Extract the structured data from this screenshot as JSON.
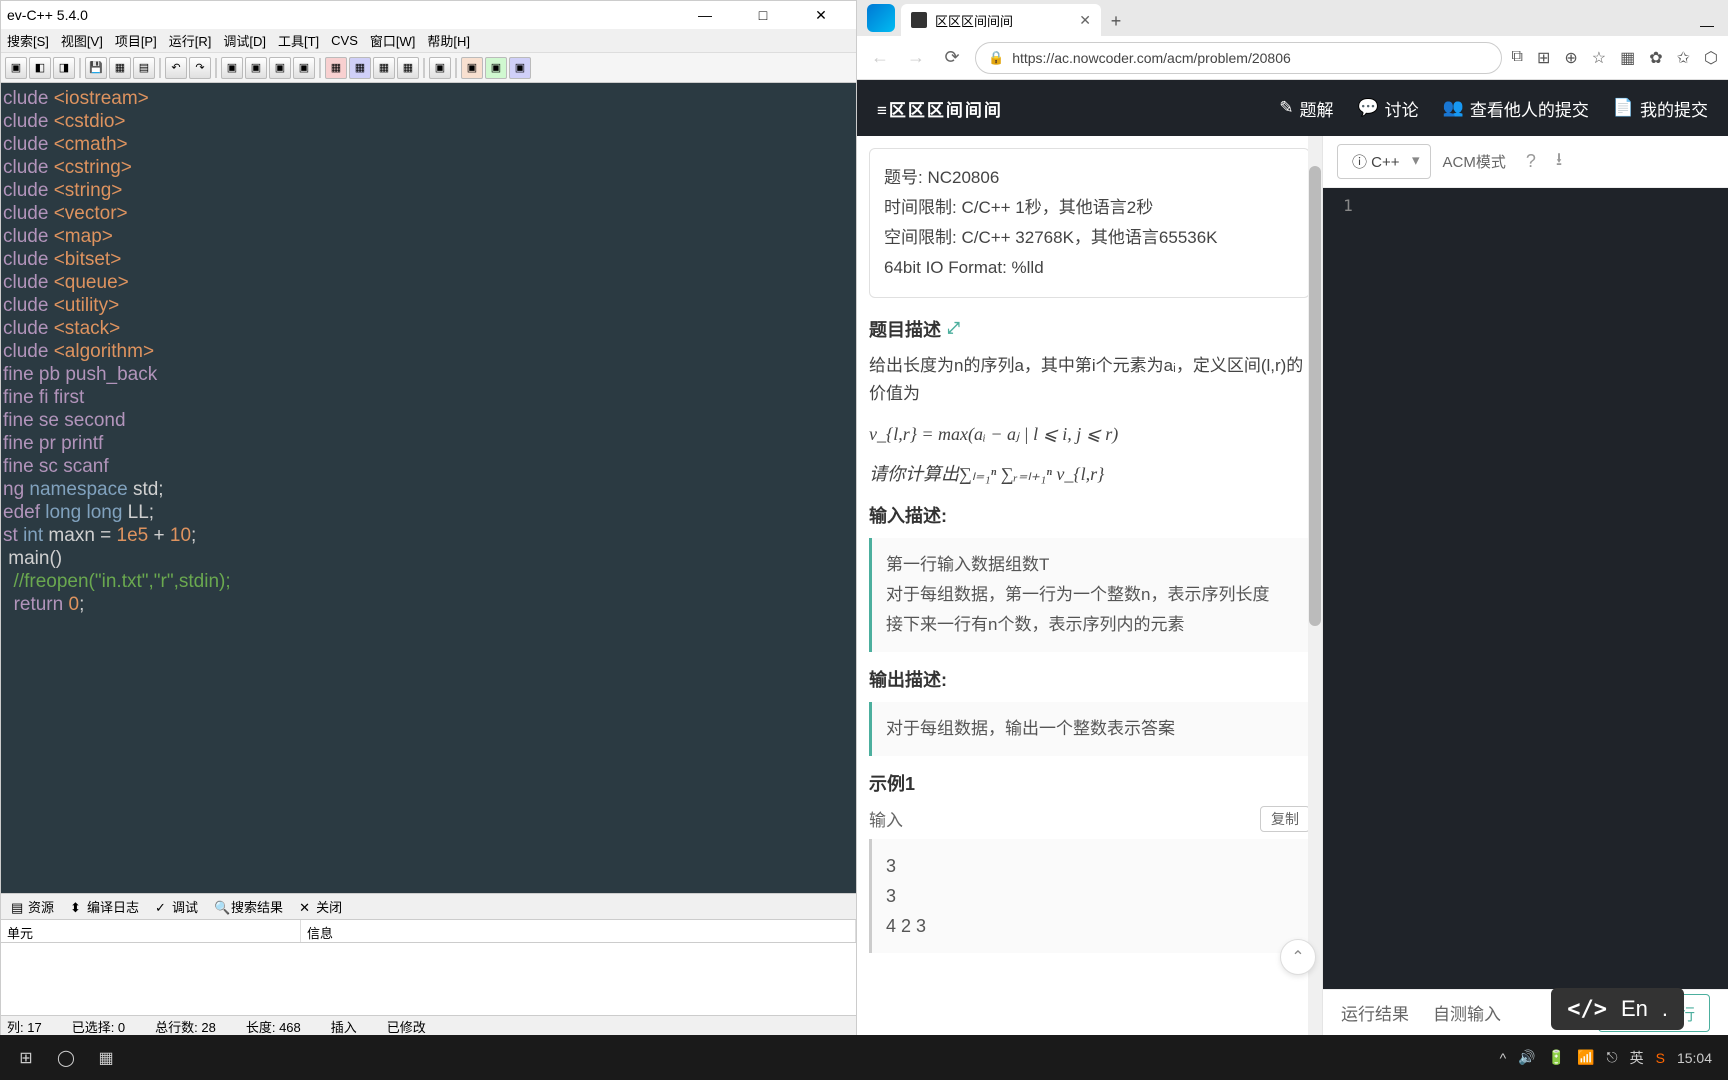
{
  "devcpp": {
    "title": "ev-C++ 5.4.0",
    "menu": [
      "搜索[S]",
      "视图[V]",
      "项目[P]",
      "运行[R]",
      "调试[D]",
      "工具[T]",
      "CVS",
      "窗口[W]",
      "帮助[H]"
    ],
    "code_lines": [
      {
        "segs": [
          {
            "t": "clude ",
            "c": "kw"
          },
          {
            "t": "<iostream>",
            "c": "str"
          }
        ]
      },
      {
        "segs": [
          {
            "t": "clude ",
            "c": "kw"
          },
          {
            "t": "<cstdio>",
            "c": "str"
          }
        ]
      },
      {
        "segs": [
          {
            "t": "clude ",
            "c": "kw"
          },
          {
            "t": "<cmath>",
            "c": "str"
          }
        ]
      },
      {
        "segs": [
          {
            "t": "clude ",
            "c": "kw"
          },
          {
            "t": "<cstring>",
            "c": "str"
          }
        ]
      },
      {
        "segs": [
          {
            "t": "clude ",
            "c": "kw"
          },
          {
            "t": "<string>",
            "c": "str"
          }
        ]
      },
      {
        "segs": [
          {
            "t": "clude ",
            "c": "kw"
          },
          {
            "t": "<vector>",
            "c": "str"
          }
        ]
      },
      {
        "segs": [
          {
            "t": "clude ",
            "c": "kw"
          },
          {
            "t": "<map>",
            "c": "str"
          }
        ]
      },
      {
        "segs": [
          {
            "t": "clude ",
            "c": "kw"
          },
          {
            "t": "<bitset>",
            "c": "str"
          }
        ]
      },
      {
        "segs": [
          {
            "t": "clude ",
            "c": "kw"
          },
          {
            "t": "<queue>",
            "c": "str"
          }
        ]
      },
      {
        "segs": [
          {
            "t": "clude ",
            "c": "kw"
          },
          {
            "t": "<utility>",
            "c": "str"
          }
        ]
      },
      {
        "segs": [
          {
            "t": "clude ",
            "c": "kw"
          },
          {
            "t": "<stack>",
            "c": "str"
          }
        ]
      },
      {
        "segs": [
          {
            "t": "clude ",
            "c": "kw"
          },
          {
            "t": "<algorithm>",
            "c": "str"
          }
        ]
      },
      {
        "segs": [
          {
            "t": "fine pb push_back",
            "c": "kw"
          }
        ]
      },
      {
        "segs": [
          {
            "t": "fine fi first",
            "c": "kw"
          }
        ]
      },
      {
        "segs": [
          {
            "t": "fine se second",
            "c": "kw"
          }
        ]
      },
      {
        "segs": [
          {
            "t": "fine pr printf",
            "c": "kw"
          }
        ]
      },
      {
        "segs": [
          {
            "t": "fine sc scanf",
            "c": "kw"
          }
        ]
      },
      {
        "segs": [
          {
            "t": "ng ",
            "c": "kw"
          },
          {
            "t": "namespace ",
            "c": "type"
          },
          {
            "t": "std;",
            "c": ""
          }
        ]
      },
      {
        "segs": [
          {
            "t": "edef ",
            "c": "kw"
          },
          {
            "t": "long long ",
            "c": "type"
          },
          {
            "t": "LL;",
            "c": ""
          }
        ]
      },
      {
        "segs": [
          {
            "t": "st ",
            "c": "kw"
          },
          {
            "t": "int ",
            "c": "type"
          },
          {
            "t": "maxn = ",
            "c": ""
          },
          {
            "t": "1e5",
            "c": "num"
          },
          {
            "t": " + ",
            "c": ""
          },
          {
            "t": "10",
            "c": "num"
          },
          {
            "t": ";",
            "c": ""
          }
        ]
      },
      {
        "segs": [
          {
            "t": "",
            "c": ""
          }
        ]
      },
      {
        "segs": [
          {
            "t": " main()",
            "c": ""
          }
        ]
      },
      {
        "segs": [
          {
            "t": "",
            "c": ""
          }
        ]
      },
      {
        "segs": [
          {
            "t": "  //freopen(\"in.txt\",\"r\",stdin);",
            "c": "cmt"
          }
        ]
      },
      {
        "segs": [
          {
            "t": "",
            "c": ""
          }
        ]
      },
      {
        "segs": [
          {
            "t": "  ",
            "c": ""
          },
          {
            "t": "return ",
            "c": "kw"
          },
          {
            "t": "0",
            "c": "num"
          },
          {
            "t": ";",
            "c": ""
          }
        ]
      }
    ],
    "bottom_tabs": [
      "资源",
      "编译日志",
      "调试",
      "搜索结果",
      "关闭"
    ],
    "grid_headers": [
      "单元",
      "信息"
    ],
    "status": {
      "line": "列:    17",
      "sel": "已选择:    0",
      "total": "总行数:    28",
      "len": "长度:    468",
      "mode": "插入",
      "mod": "已修改"
    }
  },
  "browser": {
    "tab_title": "区区区间间间",
    "url": "https://ac.nowcoder.com/acm/problem/20806",
    "nav": {
      "brand": "≡区区区间间间",
      "links": [
        "题解",
        "讨论",
        "查看他人的提交",
        "我的提交"
      ]
    },
    "lang": "C++",
    "acm": "ACM模式",
    "meta": {
      "l1": "题号: NC20806",
      "l2": "时间限制: C/C++ 1秒，其他语言2秒",
      "l3": "空间限制: C/C++ 32768K，其他语言65536K",
      "l4": "64bit IO Format: %lld"
    },
    "sec1": "题目描述",
    "desc1": "给出长度为n的序列a，其中第i个元素为aᵢ，定义区间(l,r)的价值为",
    "formula1": "v_{l,r} = max(aᵢ − aⱼ | l ⩽ i, j ⩽ r)",
    "desc2": "请你计算出∑ₗ₌₁ⁿ ∑ᵣ₌ₗ₊₁ⁿ v_{l,r}",
    "sec_in": "输入描述:",
    "in_lines": [
      "第一行输入数据组数T",
      "对于每组数据，第一行为一个整数n，表示序列长度",
      "接下来一行有n个数，表示序列内的元素"
    ],
    "sec_out": "输出描述:",
    "out_line": "对于每组数据，输出一个整数表示答案",
    "sec_ex": "示例1",
    "ex_in_label": "输入",
    "copy": "复制",
    "ex_in": [
      "3",
      "3",
      "4 2 3"
    ],
    "result_tab": "运行结果",
    "selftest_tab": "自测输入",
    "run": "自测运行",
    "gutter": "1"
  },
  "taskbar": {
    "time": "15:04",
    "lang": "英",
    "ime": "En"
  }
}
